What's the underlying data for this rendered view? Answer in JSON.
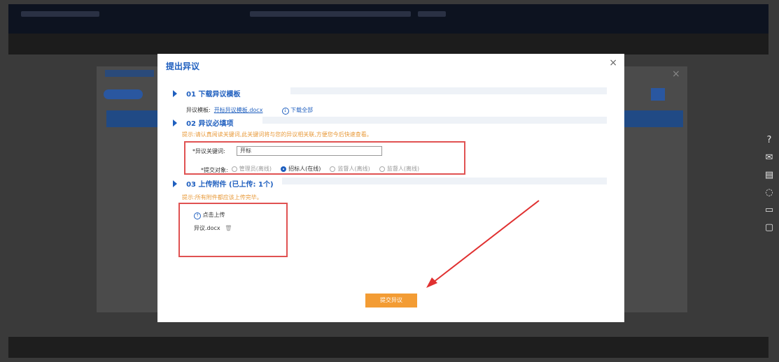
{
  "modal": {
    "title": "提出异议",
    "close": "×",
    "section1": {
      "title": "01 下载异议模板",
      "file_label": "异议模板:",
      "file_link": "开标异议模板.docx",
      "download_all": "下载全部"
    },
    "section2": {
      "title": "02 异议必填项",
      "tip": "提示:请认真阅读关键词,此关键词将与您的异议相关联,方便您今后快速查看。",
      "keyword_label": "*异议关键词:",
      "keyword_value": "开标",
      "target_label": "*提交对象:",
      "target_options": [
        {
          "label": "管理员(离线)",
          "selected": false
        },
        {
          "label": "招标人(在线)",
          "selected": true
        },
        {
          "label": "监督人(离线)",
          "selected": false
        },
        {
          "label": "监督人(离线)",
          "selected": false
        }
      ]
    },
    "section3": {
      "title": "03 上传附件 (已上传: 1个)",
      "tip": "提示:所有附件都应该上传完毕。",
      "upload_button": "点击上传",
      "uploaded_file": "异议.docx"
    },
    "submit": "提交异议"
  }
}
